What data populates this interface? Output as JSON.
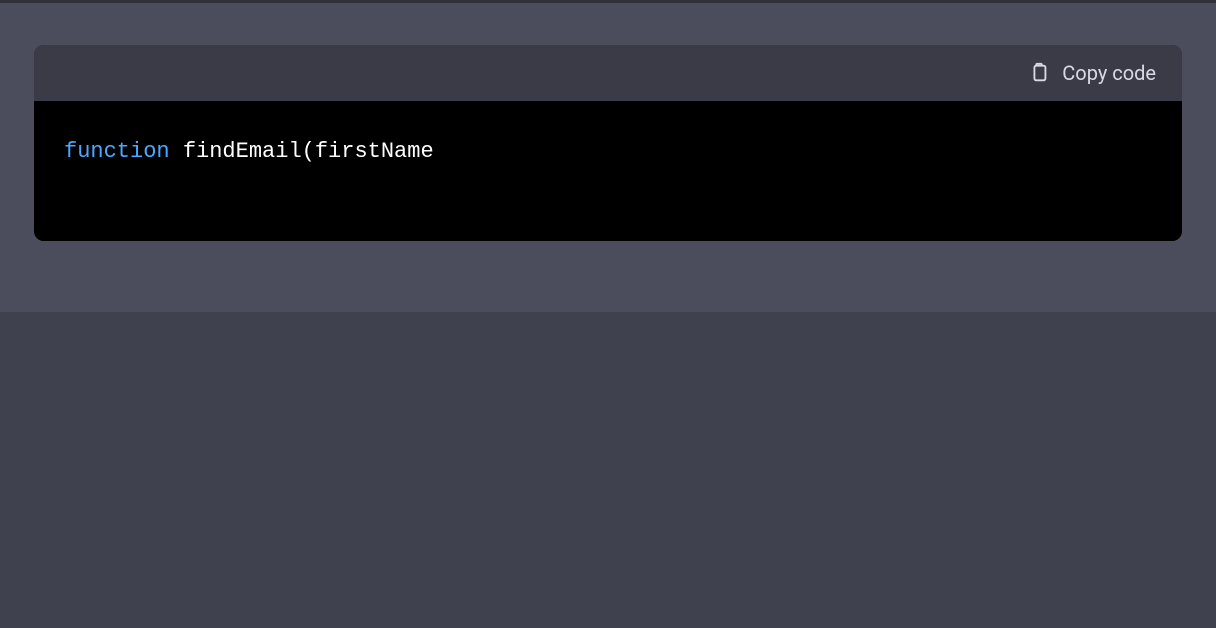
{
  "codeBlock": {
    "header": {
      "copy_label": "Copy code"
    },
    "tokens": {
      "keyword": "function",
      "rest": " findEmail(firstName"
    }
  }
}
